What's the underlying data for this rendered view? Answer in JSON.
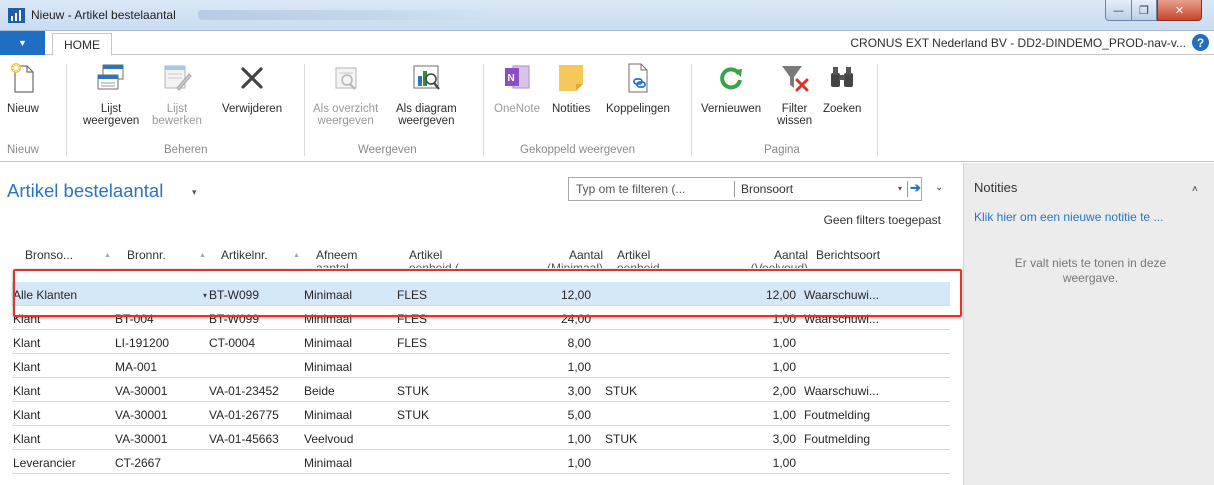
{
  "window": {
    "title": "Nieuw - Artikel bestelaantal",
    "controls": {
      "minimize": "—",
      "maximize": "❐",
      "close": "✕"
    }
  },
  "ribbon": {
    "file_tab": "▼",
    "home_tab": "HOME",
    "company": "CRONUS EXT Nederland BV - DD2-DINDEMO_PROD-nav-v...",
    "help": "?",
    "buttons": {
      "nieuw": "Nieuw",
      "lijst_weergeven": [
        "Lijst",
        "weergeven"
      ],
      "lijst_bewerken": [
        "Lijst",
        "bewerken"
      ],
      "verwijderen": "Verwijderen",
      "als_overzicht": [
        "Als overzicht",
        "weergeven"
      ],
      "als_diagram": [
        "Als diagram",
        "weergeven"
      ],
      "onenote": "OneNote",
      "notities": "Notities",
      "koppelingen": "Koppelingen",
      "vernieuwen": "Vernieuwen",
      "filter_wissen": [
        "Filter",
        "wissen"
      ],
      "zoeken": "Zoeken"
    },
    "groups": {
      "nieuw": "Nieuw",
      "beheren": "Beheren",
      "weergeven": "Weergeven",
      "gekoppeld": "Gekoppeld weergeven",
      "pagina": "Pagina"
    },
    "colors": {
      "accent": "#1f6ec2",
      "delete_x": "#444444",
      "filter_x": "#d9342b",
      "refresh": "#3aa34a"
    }
  },
  "page": {
    "title": "Artikel bestelaantal",
    "title_caret": "▾",
    "filter": {
      "placeholder": "Typ om te filteren (...",
      "field": "Bronsoort",
      "dropdown": "▾",
      "go": "➔"
    },
    "collapse": "⌄",
    "no_filters": "Geen filters toegepast"
  },
  "table": {
    "headers": [
      {
        "line1": "Bronso...",
        "line2": ""
      },
      {
        "line1": "Bronnr.",
        "line2": ""
      },
      {
        "line1": "Artikelnr.",
        "line2": ""
      },
      {
        "line1": "Afneem",
        "line2": "aantal"
      },
      {
        "line1": "Artikel",
        "line2": "eenheid (..."
      },
      {
        "line1": "Aantal",
        "line2": "(Minimaal)"
      },
      {
        "line1": "Artikel",
        "line2": "eenheid ..."
      },
      {
        "line1": "Aantal",
        "line2": "(Veelvoud)"
      },
      {
        "line1": "Berichtsoort",
        "line2": ""
      }
    ],
    "rows": [
      [
        "Alle Klanten",
        "",
        "BT-W099",
        "Minimaal",
        "FLES",
        "12,00",
        "",
        "12,00",
        "Waarschuwi..."
      ],
      [
        "Klant",
        "BT-004",
        "BT-W099",
        "Minimaal",
        "FLES",
        "24,00",
        "",
        "1,00",
        "Waarschuwi..."
      ],
      [
        "Klant",
        "LI-191200",
        "CT-0004",
        "Minimaal",
        "FLES",
        "8,00",
        "",
        "1,00",
        ""
      ],
      [
        "Klant",
        "MA-001",
        "",
        "Minimaal",
        "",
        "1,00",
        "",
        "1,00",
        ""
      ],
      [
        "Klant",
        "VA-30001",
        "VA-01-23452",
        "Beide",
        "STUK",
        "3,00",
        "STUK",
        "2,00",
        "Waarschuwi..."
      ],
      [
        "Klant",
        "VA-30001",
        "VA-01-26775",
        "Minimaal",
        "STUK",
        "5,00",
        "",
        "1,00",
        "Foutmelding"
      ],
      [
        "Klant",
        "VA-30001",
        "VA-01-45663",
        "Veelvoud",
        "",
        "1,00",
        "STUK",
        "3,00",
        "Foutmelding"
      ],
      [
        "Leverancier",
        "CT-2667",
        "",
        "Minimaal",
        "",
        "1,00",
        "",
        "1,00",
        ""
      ]
    ],
    "selected_row": 0,
    "dropdown_arrow": "▾",
    "sort_arrow": "▲",
    "highlight_color": "#e0332a"
  },
  "notes": {
    "title": "Notities",
    "caret": "˄",
    "add_link": "Klik hier om een nieuwe notitie te ...",
    "empty": "Er valt niets te tonen in deze weergave."
  }
}
